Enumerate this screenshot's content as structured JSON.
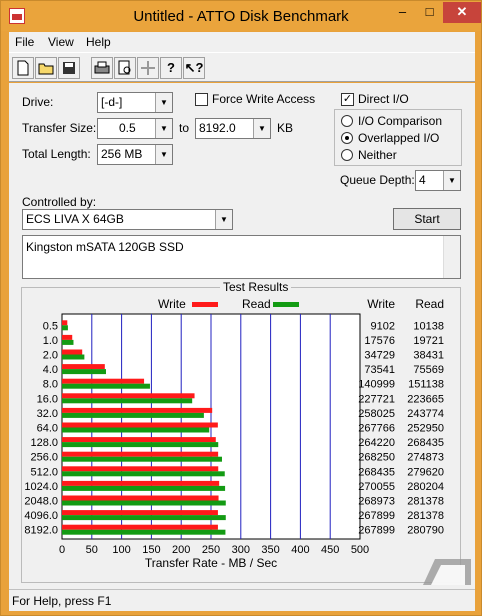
{
  "window": {
    "title": "Untitled - ATTO Disk Benchmark",
    "minimize": "–",
    "maximize": "□",
    "close": "✕"
  },
  "menu": [
    "File",
    "View",
    "Help"
  ],
  "toolbar": {
    "icons": [
      "new-file-icon",
      "open-folder-icon",
      "save-icon",
      "print-icon",
      "print-preview-icon",
      "move-icon",
      "help-icon",
      "context-help-icon"
    ]
  },
  "form": {
    "drive_label": "Drive:",
    "drive_value": "[-d-]",
    "force_write_label": "Force Write Access",
    "force_write_checked": false,
    "direct_io_label": "Direct I/O",
    "direct_io_checked": true,
    "transfer_size_label": "Transfer Size:",
    "transfer_from": "0.5",
    "to_label": "to",
    "transfer_to": "8192.0",
    "kb_label": "KB",
    "total_length_label": "Total Length:",
    "total_length_value": "256 MB",
    "io_options": [
      "I/O Comparison",
      "Overlapped I/O",
      "Neither"
    ],
    "io_selected": 1,
    "queue_depth_label": "Queue Depth:",
    "queue_depth_value": "4",
    "controlled_by_label": "Controlled by:",
    "controlled_by_value": "ECS LIVA X 64GB",
    "start_label": "Start",
    "description": "Kingston mSATA 120GB SSD"
  },
  "results": {
    "title": "Test Results",
    "legend_write": "Write",
    "legend_read": "Read",
    "col_write": "Write",
    "col_read": "Read",
    "write_color": "#ff1a1a",
    "read_color": "#139b13"
  },
  "chart_data": {
    "type": "bar",
    "title": "Test Results",
    "xlabel": "Transfer Rate - MB / Sec",
    "xlim": [
      0,
      500
    ],
    "xticks": [
      0,
      50,
      100,
      150,
      200,
      250,
      300,
      350,
      400,
      450,
      500
    ],
    "categories": [
      "0.5",
      "1.0",
      "2.0",
      "4.0",
      "8.0",
      "16.0",
      "32.0",
      "64.0",
      "128.0",
      "256.0",
      "512.0",
      "1024.0",
      "2048.0",
      "4096.0",
      "8192.0"
    ],
    "series": [
      {
        "name": "Write",
        "color": "#ff1a1a",
        "values": [
          9102,
          17576,
          34729,
          73541,
          140999,
          227721,
          258025,
          267766,
          264220,
          268250,
          268435,
          270055,
          268973,
          267899,
          267899
        ]
      },
      {
        "name": "Read",
        "color": "#139b13",
        "values": [
          10138,
          19721,
          38431,
          75569,
          151138,
          223665,
          243774,
          252950,
          268435,
          274873,
          279620,
          280204,
          281378,
          281378,
          280790
        ]
      }
    ],
    "value_units": "KB/sec",
    "grid": true
  },
  "status": {
    "text": "For Help, press F1"
  }
}
